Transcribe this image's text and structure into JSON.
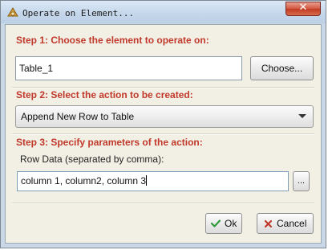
{
  "window": {
    "title": "Operate on Element...",
    "close_label": "✕"
  },
  "step1": {
    "heading": "Step 1: Choose the element to operate on:",
    "element_value": "Table_1",
    "choose_label": "Choose..."
  },
  "step2": {
    "heading": "Step 2: Select the action to be created:",
    "action_selected": "Append New Row to Table"
  },
  "step3": {
    "heading": "Step 3: Specify parameters of the action:",
    "param_label": "Row Data (separated by comma):",
    "param_value": "column 1, column2, column 3",
    "browse_label": "..."
  },
  "footer": {
    "ok_label": "Ok",
    "cancel_label": "Cancel"
  },
  "colors": {
    "step_heading": "#c0392b",
    "ok_icon": "#2e9a3b",
    "cancel_icon": "#c0392b"
  },
  "icons": {
    "title": "gear-app-icon",
    "ok": "check-icon",
    "cancel": "cross-icon",
    "dropdown": "chevron-down-icon"
  }
}
